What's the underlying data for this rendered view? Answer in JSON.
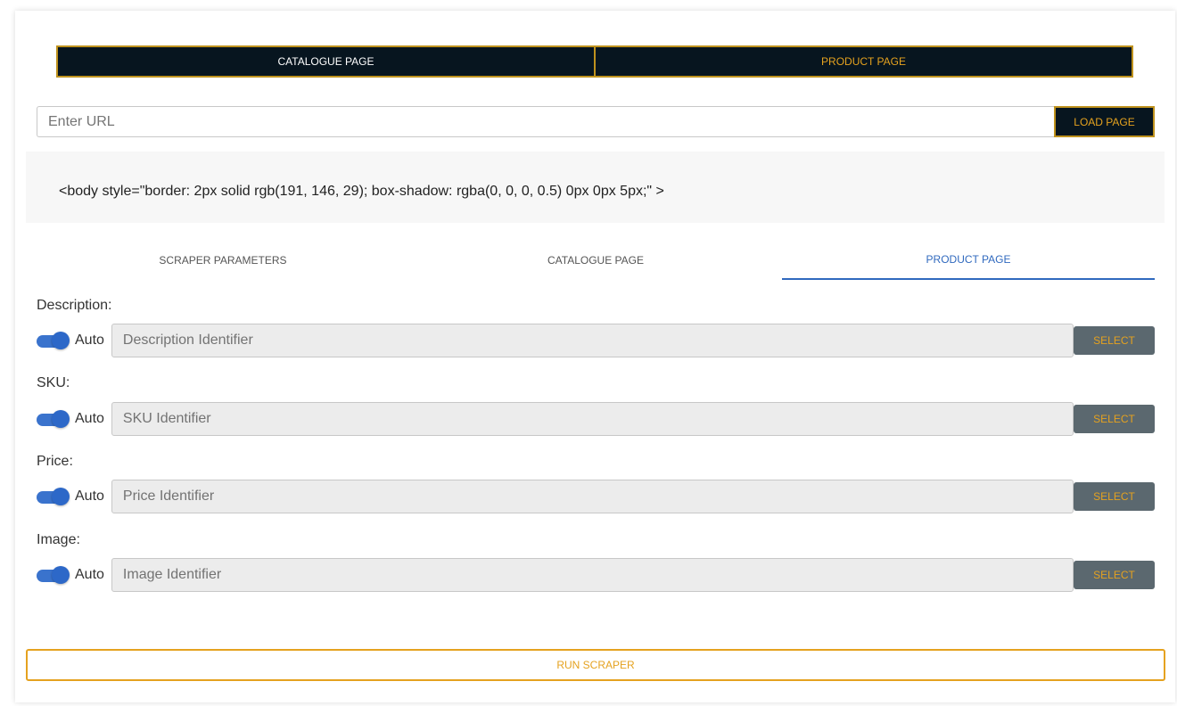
{
  "mode_switch": {
    "catalogue_label": "CATALOGUE PAGE",
    "product_label": "PRODUCT PAGE"
  },
  "url_bar": {
    "placeholder": "Enter URL",
    "value": "",
    "load_label": "LOAD PAGE"
  },
  "selected_element": {
    "code": "<body style=\"border: 2px solid rgb(191, 146, 29); box-shadow: rgba(0, 0, 0, 0.5) 0px 0px 5px;\" >"
  },
  "tabs": [
    {
      "label": "SCRAPER PARAMETERS",
      "active": false
    },
    {
      "label": "CATALOGUE PAGE",
      "active": false
    },
    {
      "label": "PRODUCT PAGE",
      "active": true
    }
  ],
  "fields": [
    {
      "label": "Description:",
      "auto_label": "Auto",
      "auto_on": true,
      "placeholder": "Description Identifier",
      "select_label": "SELECT"
    },
    {
      "label": "SKU:",
      "auto_label": "Auto",
      "auto_on": true,
      "placeholder": "SKU Identifier",
      "select_label": "SELECT"
    },
    {
      "label": "Price:",
      "auto_label": "Auto",
      "auto_on": true,
      "placeholder": "Price Identifier",
      "select_label": "SELECT"
    },
    {
      "label": "Image:",
      "auto_label": "Auto",
      "auto_on": true,
      "placeholder": "Image Identifier",
      "select_label": "SELECT"
    }
  ],
  "run_label": "RUN SCRAPER",
  "colors": {
    "gold": "#e5a21f",
    "gold_border": "#bf921d",
    "dark": "#07151f",
    "blue": "#3069be",
    "select_bg": "#5b686f"
  },
  "icons": {
    "toggle": "toggle-switch-icon"
  }
}
